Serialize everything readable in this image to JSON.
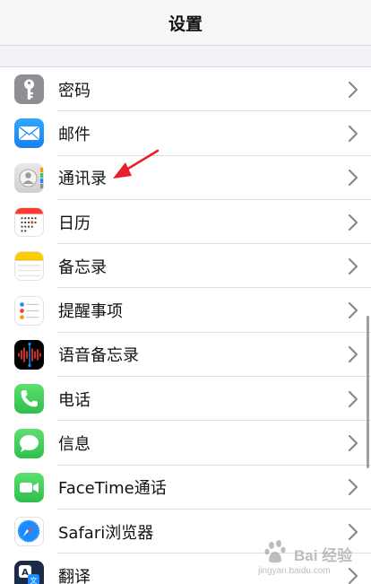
{
  "nav": {
    "title": "设置"
  },
  "rows": [
    {
      "id": "passwords",
      "label": "密码",
      "icon": "key-icon",
      "color": "#8e8e93"
    },
    {
      "id": "mail",
      "label": "邮件",
      "icon": "mail-icon",
      "color": "#1a8cff"
    },
    {
      "id": "contacts",
      "label": "通讯录",
      "icon": "contacts-icon",
      "color": "#d9d9d9"
    },
    {
      "id": "calendar",
      "label": "日历",
      "icon": "calendar-icon",
      "color": "#ffffff"
    },
    {
      "id": "notes",
      "label": "备忘录",
      "icon": "notes-icon",
      "color": "#ffffff"
    },
    {
      "id": "reminders",
      "label": "提醒事项",
      "icon": "reminders-icon",
      "color": "#ffffff"
    },
    {
      "id": "voice-memos",
      "label": "语音备忘录",
      "icon": "voice-memos-icon",
      "color": "#000000"
    },
    {
      "id": "phone",
      "label": "电话",
      "icon": "phone-icon",
      "color": "#34c759"
    },
    {
      "id": "messages",
      "label": "信息",
      "icon": "messages-icon",
      "color": "#34c759"
    },
    {
      "id": "facetime",
      "label": "FaceTime通话",
      "icon": "facetime-icon",
      "color": "#34c759"
    },
    {
      "id": "safari",
      "label": "Safari浏览器",
      "icon": "safari-icon",
      "color": "#1a8cff"
    },
    {
      "id": "translate",
      "label": "翻译",
      "icon": "translate-icon",
      "color": "#1c2a4a"
    }
  ],
  "annotation": {
    "icon": "red-arrow-icon",
    "color": "#e8202a",
    "target": "contacts"
  },
  "watermark": {
    "line1": "Bai 经验",
    "line2": "jingyan.baidu.com"
  }
}
